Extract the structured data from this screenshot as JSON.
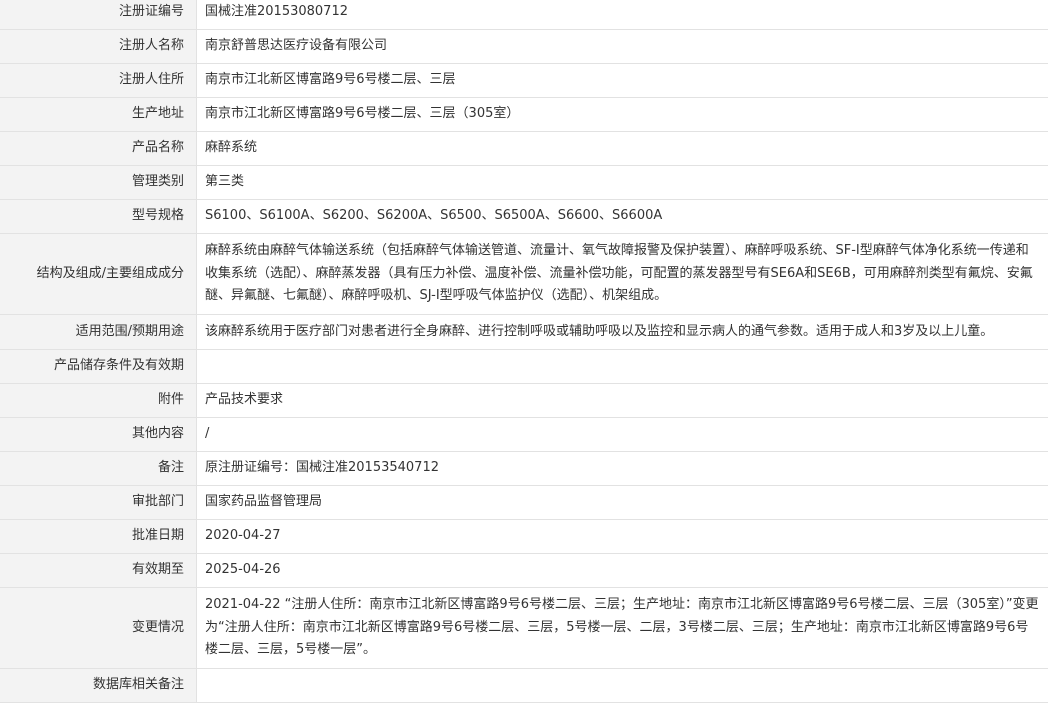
{
  "rows": [
    {
      "label": "注册证编号",
      "value": "国械注准20153080712"
    },
    {
      "label": "注册人名称",
      "value": "南京舒普思达医疗设备有限公司"
    },
    {
      "label": "注册人住所",
      "value": "南京市江北新区博富路9号6号楼二层、三层"
    },
    {
      "label": "生产地址",
      "value": "南京市江北新区博富路9号6号楼二层、三层（305室）"
    },
    {
      "label": "产品名称",
      "value": "麻醉系统"
    },
    {
      "label": "管理类别",
      "value": "第三类"
    },
    {
      "label": "型号规格",
      "value": "S6100、S6100A、S6200、S6200A、S6500、S6500A、S6600、S6600A"
    },
    {
      "label": "结构及组成/主要组成成分",
      "value": "麻醉系统由麻醉气体输送系统（包括麻醉气体输送管道、流量计、氧气故障报警及保护装置）、麻醉呼吸系统、SF-I型麻醉气体净化系统一传递和收集系统（选配）、麻醉蒸发器（具有压力补偿、温度补偿、流量补偿功能，可配置的蒸发器型号有SE6A和SE6B，可用麻醉剂类型有氟烷、安氟醚、异氟醚、七氟醚）、麻醉呼吸机、SJ-I型呼吸气体监护仪（选配）、机架组成。"
    },
    {
      "label": "适用范围/预期用途",
      "value": "该麻醉系统用于医疗部门对患者进行全身麻醉、进行控制呼吸或辅助呼吸以及监控和显示病人的通气参数。适用于成人和3岁及以上儿童。"
    },
    {
      "label": "产品储存条件及有效期",
      "value": ""
    },
    {
      "label": "附件",
      "value": "产品技术要求"
    },
    {
      "label": "其他内容",
      "value": "/"
    },
    {
      "label": "备注",
      "value": "原注册证编号：国械注准20153540712"
    },
    {
      "label": "审批部门",
      "value": "国家药品监督管理局"
    },
    {
      "label": "批准日期",
      "value": "2020-04-27"
    },
    {
      "label": "有效期至",
      "value": "2025-04-26"
    },
    {
      "label": "变更情况",
      "value": "2021-04-22 “注册人住所：南京市江北新区博富路9号6号楼二层、三层；生产地址：南京市江北新区博富路9号6号楼二层、三层（305室）”变更为“注册人住所：南京市江北新区博富路9号6号楼二层、三层，5号楼一层、二层，3号楼二层、三层；生产地址：南京市江北新区博富路9号6号楼二层、三层，5号楼一层”。"
    },
    {
      "label": "数据库相关备注",
      "value": ""
    }
  ]
}
